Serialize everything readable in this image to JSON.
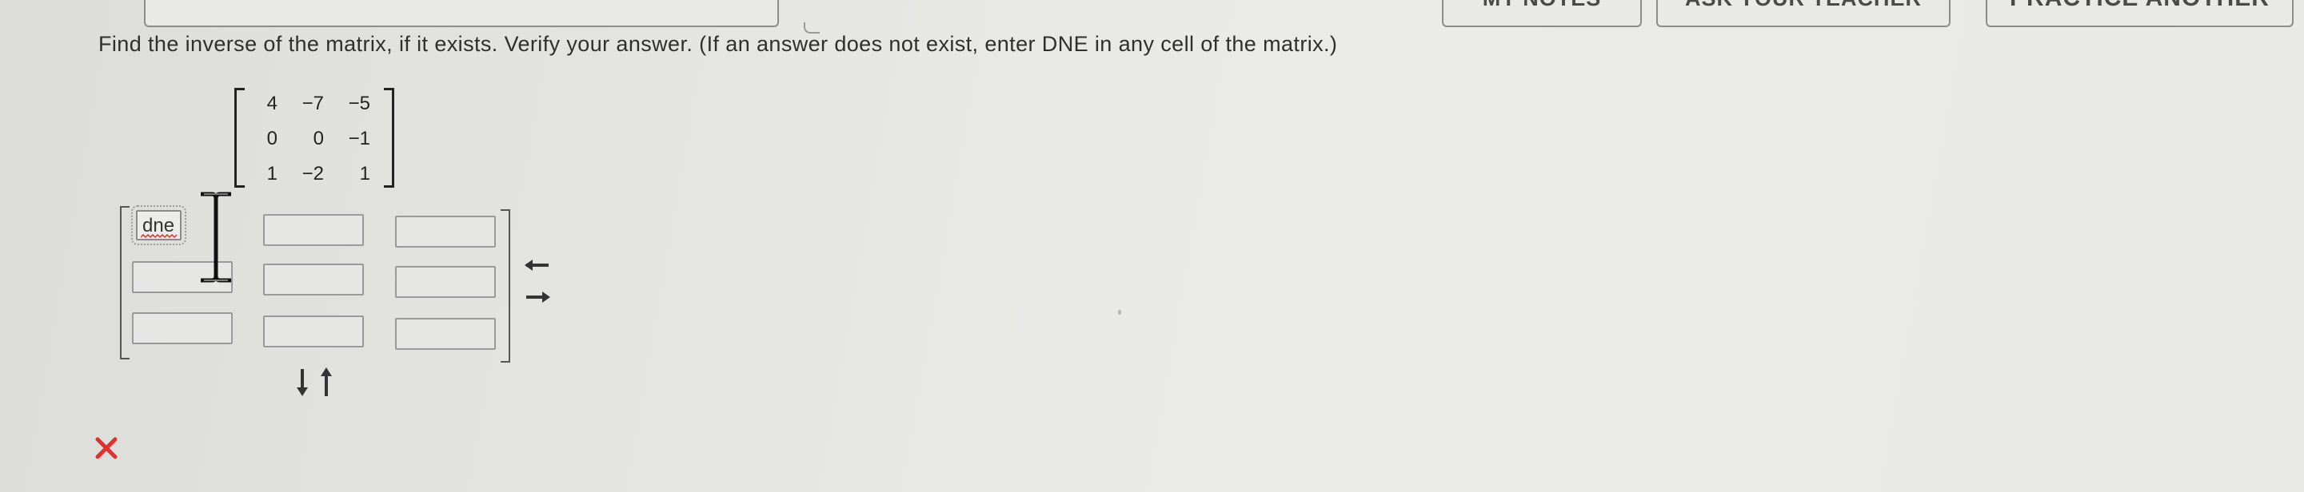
{
  "top_buttons": {
    "notes_label": "MY NOTES",
    "ask_label": "ASK YOUR TEACHER",
    "practice_label": "PRACTICE ANOTHER"
  },
  "question": {
    "text": "Find the inverse of the matrix, if it exists. Verify your answer. (If an answer does not exist, enter DNE in any cell of the matrix.)"
  },
  "given_matrix": [
    [
      "4",
      "−7",
      "−5"
    ],
    [
      "0",
      "0",
      "−1"
    ],
    [
      "1",
      "−2",
      "1"
    ]
  ],
  "answer_matrix": {
    "cells": [
      [
        "dne",
        "",
        ""
      ],
      [
        "",
        "",
        ""
      ],
      [
        "",
        "",
        ""
      ]
    ]
  },
  "icons": {
    "column_arrows": "arrow-down-up-icon",
    "row_arrows": "arrow-left-right-icon",
    "result": "incorrect-x-icon",
    "cursor": "text-cursor-icon"
  },
  "colors": {
    "incorrect": "#e03030",
    "spellcheck": "#e03030"
  }
}
